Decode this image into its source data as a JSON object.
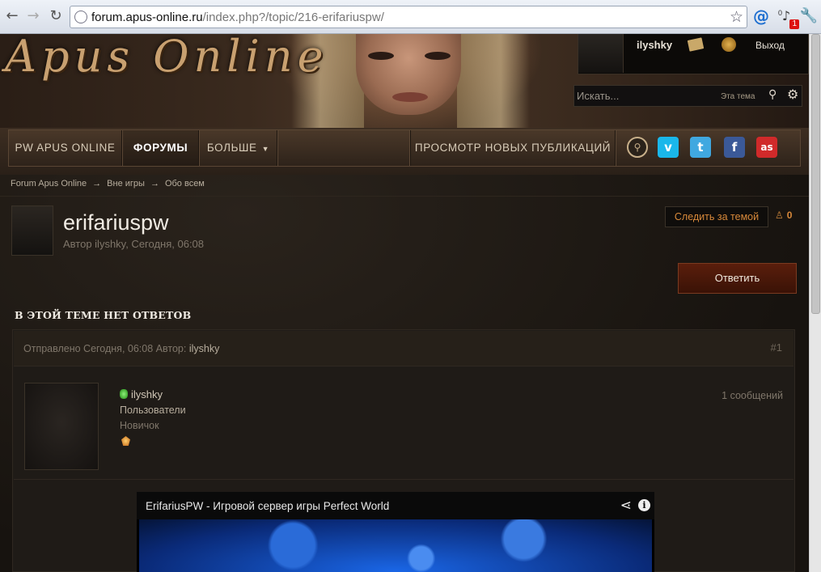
{
  "browser": {
    "url_host": "forum.apus-online.ru",
    "url_path": "/index.php?/topic/216-erifariuspw/",
    "notification_count": "1",
    "notification_small": "0",
    "icons": [
      "back-icon",
      "forward-icon",
      "reload-icon",
      "globe-icon",
      "star-icon",
      "mail-icon",
      "bell-icon",
      "wrench-icon"
    ]
  },
  "header": {
    "logo_text": "Apus Online",
    "user": {
      "name": "ilyshky",
      "logout_label": "Выход"
    },
    "search": {
      "placeholder": "Искать...",
      "scope_label": "Эта тема"
    }
  },
  "nav": {
    "items": [
      {
        "label": "PW Apus Online"
      },
      {
        "label": "Форумы"
      },
      {
        "label": "Больше"
      },
      {
        "label": "Просмотр новых публикаций"
      }
    ],
    "socials": [
      "pin-icon",
      "vimeo-icon",
      "twitter-icon",
      "facebook-icon",
      "lastfm-icon"
    ],
    "social_glyphs": {
      "pin": "⚲",
      "vimeo": "v",
      "twitter": "t",
      "facebook": "f",
      "lastfm": "as"
    }
  },
  "breadcrumbs": [
    "Forum Apus Online",
    "Вне игры",
    "Обо всем"
  ],
  "topic": {
    "title": "erifariuspw",
    "meta": "Автор ilyshky, Сегодня, 06:08",
    "follow_label": "Следить за темой",
    "followers": "0",
    "reply_label": "Ответить",
    "no_replies_label": "В ЭТОЙ ТЕМЕ НЕТ ОТВЕТОВ"
  },
  "post": {
    "sent_prefix": "Отправлено Сегодня, 06:08 Автор:",
    "author": "ilyshky",
    "number": "#1",
    "author_group": "Пользователи",
    "author_rank": "Новичок",
    "post_count": "1 сообщений",
    "video_title": "ErifariusPW - Игровой сервер игры Perfect World"
  },
  "colors": {
    "accent": "#d8893a",
    "reply_button": "#5a1e0c",
    "text": "#c9bfb0"
  }
}
